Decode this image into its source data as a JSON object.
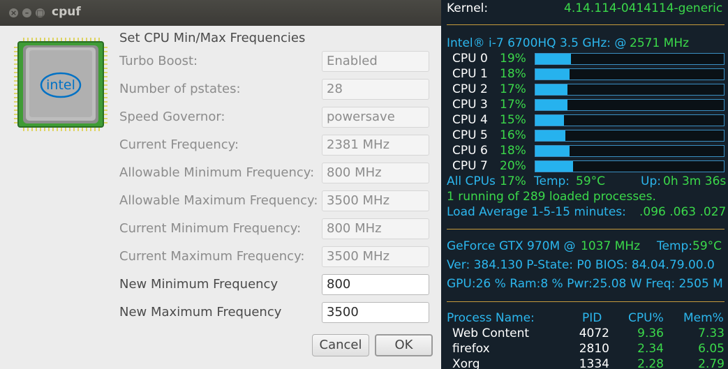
{
  "dialog": {
    "title": "cpuf",
    "heading": "Set CPU Min/Max Frequencies",
    "fields": [
      {
        "label": "Turbo Boost:",
        "value": "Enabled"
      },
      {
        "label": "Number of pstates:",
        "value": "28"
      },
      {
        "label": "Speed Governor:",
        "value": "powersave"
      },
      {
        "label": "Current Frequency:",
        "value": "2381 MHz"
      },
      {
        "label": "Allowable Minimum Frequency:",
        "value": "800 MHz"
      },
      {
        "label": "Allowable Maximum Frequency:",
        "value": "3500 MHz"
      },
      {
        "label": "Current Minimum Frequency:",
        "value": "800 MHz"
      },
      {
        "label": "Current Maximum Frequency:",
        "value": "3500 MHz"
      },
      {
        "label": "New Minimum Frequency",
        "value": "800"
      },
      {
        "label": "New Maximum Frequency",
        "value": "3500"
      }
    ],
    "cancel_label": "Cancel",
    "ok_label": "OK",
    "chip_logo": "intel"
  },
  "conky": {
    "kernel_label": "Kernel:",
    "kernel_value": "4.14.114-0414114-generic",
    "cpu_model": "Intel® i-7 6700HQ 3.5 GHz: @",
    "cpu_freq": "2571 MHz",
    "cpus": [
      {
        "name": "CPU 0",
        "pct": "19%",
        "fill": 0.19
      },
      {
        "name": "CPU 1",
        "pct": "18%",
        "fill": 0.18
      },
      {
        "name": "CPU 2",
        "pct": "17%",
        "fill": 0.17
      },
      {
        "name": "CPU 3",
        "pct": "17%",
        "fill": 0.17
      },
      {
        "name": "CPU 4",
        "pct": "15%",
        "fill": 0.15
      },
      {
        "name": "CPU 5",
        "pct": "16%",
        "fill": 0.16
      },
      {
        "name": "CPU 6",
        "pct": "18%",
        "fill": 0.18
      },
      {
        "name": "CPU 7",
        "pct": "20%",
        "fill": 0.2
      }
    ],
    "all_cpus_label": "All CPUs",
    "all_cpus_value": "17%",
    "temp_label": "Temp:",
    "temp_value": "59°C",
    "uptime_label": "Up:",
    "uptime_value": "0h 3m 36s",
    "processes_text": "1 running of 289 loaded processes.",
    "load_label": "Load Average 1-5-15 minutes:",
    "load_value": ".096 .063 .027",
    "gpu_name": "GeForce GTX 970M @",
    "gpu_freq": "1037 MHz",
    "gpu_temp_label": "Temp:",
    "gpu_temp_value": "59°C",
    "gpu_ver_line": "Ver: 384.130  P-State: P0 BIOS: 84.04.79.00.0",
    "gpu_usage_line": "GPU:26 % Ram:8 % Pwr:25.08 W Freq: 2505 M",
    "proc_headers": [
      "Process Name:",
      "PID",
      "CPU%",
      "Mem%"
    ],
    "processes": [
      {
        "name": "Web Content",
        "pid": "4072",
        "cpu": "9.36",
        "mem": "7.33"
      },
      {
        "name": "firefox",
        "pid": "2810",
        "cpu": "2.34",
        "mem": "6.05"
      },
      {
        "name": "Xorg",
        "pid": "1334",
        "cpu": "2.28",
        "mem": "2.79"
      }
    ]
  },
  "colors": {
    "conky_white": "#ffffff",
    "conky_green": "#3bd94a",
    "conky_blue": "#2cb7ee",
    "separator": "#c69b3c",
    "intel_blue": "#0071c5"
  }
}
